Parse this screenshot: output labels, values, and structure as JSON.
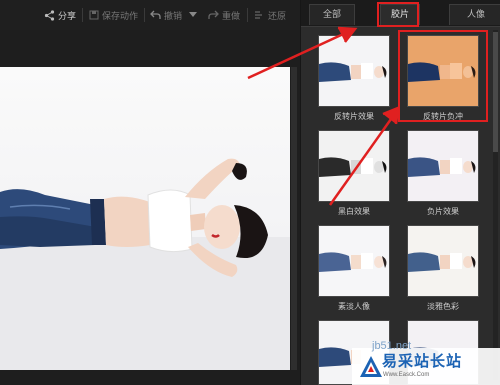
{
  "toolbar": {
    "share": "分享",
    "save_action": "保存动作",
    "undo": "撤销",
    "redo": "重做",
    "restore": "还原"
  },
  "panel": {
    "tabs": [
      "全部",
      "胶片",
      "人像"
    ],
    "selected_tab": "胶片",
    "effects": [
      {
        "label": "反转片效果",
        "tone": "color"
      },
      {
        "label": "反转片负冲",
        "tone": "orange"
      },
      {
        "label": "黑白效果",
        "tone": "bw"
      },
      {
        "label": "负片效果",
        "tone": "color"
      },
      {
        "label": "素淡人像",
        "tone": "color"
      },
      {
        "label": "淡雅色彩",
        "tone": "color"
      },
      {
        "label": "",
        "tone": "color"
      },
      {
        "label": "",
        "tone": "color"
      }
    ]
  },
  "watermark": {
    "url": "jb51.net",
    "title": "易采站长站",
    "subtitle": "Www.Easck.Com"
  },
  "colors": {
    "annotation_red": "#e02020",
    "denim": "#2d4a7a",
    "orange_filter": "#e9a46a"
  }
}
